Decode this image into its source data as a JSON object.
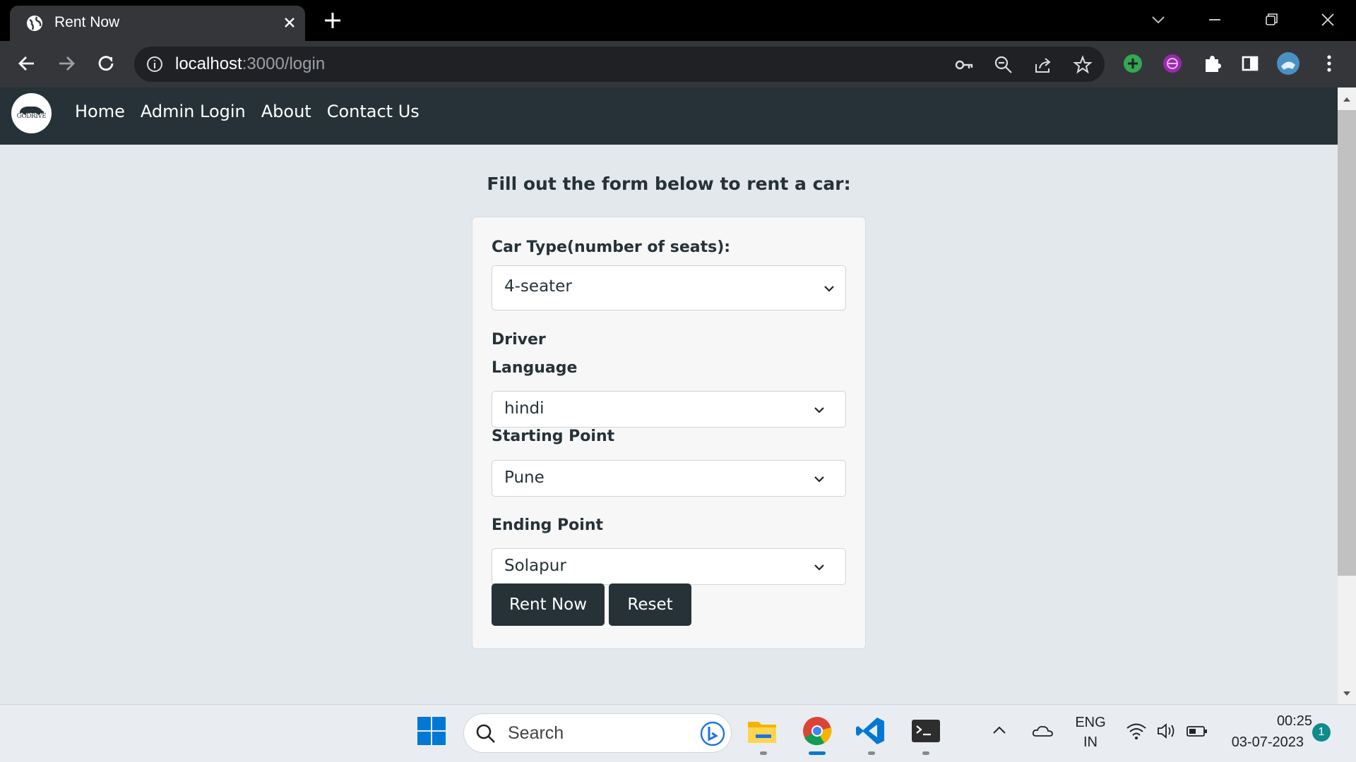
{
  "browser": {
    "tab_title": "Rent Now",
    "url_host": "localhost",
    "url_rest": ":3000/login"
  },
  "site": {
    "logo_text": "GODRIVE",
    "nav": [
      "Home",
      "Admin Login",
      "About",
      "Contact Us"
    ]
  },
  "form": {
    "heading": "Fill out the form below to rent a car:",
    "car_type_label": "Car Type(number of seats):",
    "car_type_value": "4-seater",
    "driver_label": "Driver",
    "language_label": "Language",
    "language_value": "hindi",
    "start_label": "Starting Point",
    "start_value": "Pune",
    "end_label": "Ending Point",
    "end_value": "Solapur",
    "rent_button": "Rent Now",
    "reset_button": "Reset"
  },
  "taskbar": {
    "search_placeholder": "Search",
    "lang_line1": "ENG",
    "lang_line2": "IN",
    "time": "00:25",
    "date": "03-07-2023",
    "notification_count": "1"
  },
  "colors": {
    "navbar": "#263238",
    "page_bg": "#e3e8ec",
    "button": "#263238"
  }
}
